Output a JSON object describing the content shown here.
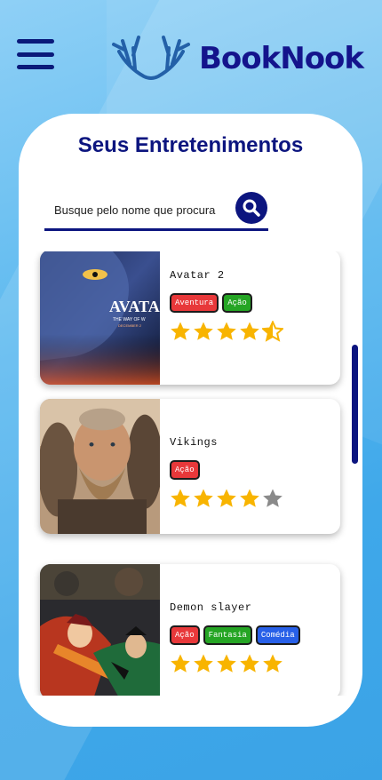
{
  "header": {
    "brand": "BookNook",
    "menu_icon": "hamburger-menu-icon",
    "logo_icon": "antlers-logo-icon",
    "brand_color": "#14148c"
  },
  "page": {
    "title": "Seus Entretenimentos"
  },
  "search": {
    "placeholder": "Busque pelo nome que procura",
    "icon": "search-icon"
  },
  "colors": {
    "accent": "#0c157f",
    "tag_red": "#e8383a",
    "tag_green": "#25a524",
    "tag_blue": "#2860e8",
    "star_filled": "#f8b400",
    "star_empty": "#8a8a8a"
  },
  "items": [
    {
      "title": "Avatar 2",
      "tags": [
        "Aventura",
        "Ação"
      ],
      "rating": 4.5,
      "rating_max": 5
    },
    {
      "title": "Vikings",
      "tags": [
        "Ação"
      ],
      "rating": 4,
      "rating_max": 5
    },
    {
      "title": "Demon slayer",
      "tags": [
        "Ação",
        "Fantasia",
        "Comédia"
      ],
      "rating": 5,
      "rating_max": 5
    }
  ]
}
